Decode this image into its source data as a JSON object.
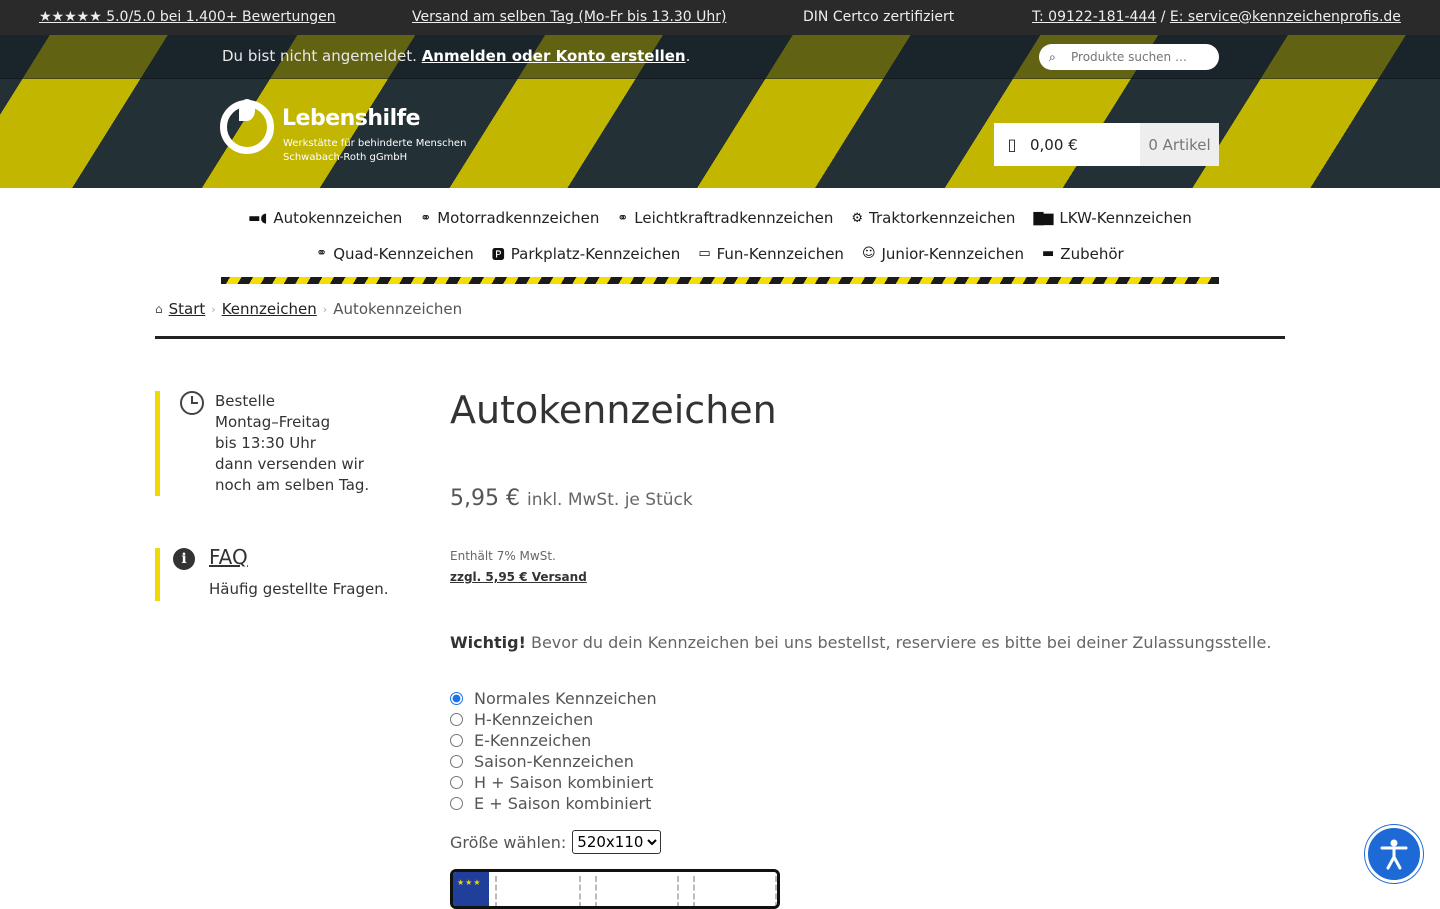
{
  "topbar": {
    "rating": "★★★★★ 5.0/5.0 bei 1.400+ Bewertungen",
    "shipping": "Versand am selben Tag (Mo-Fr bis 13.30 Uhr)",
    "certified": "DIN Certco zertifiziert",
    "phone": "T: 09122-181-444",
    "separator": "/",
    "email": "E: service@kennzeichenprofis.de"
  },
  "header": {
    "login_prefix": "Du bist nicht angemeldet.",
    "login_link": "Anmelden oder Konto erstellen",
    "login_suffix": ".",
    "search_placeholder": "Produkte suchen …",
    "logo_name": "Lebenshilfe",
    "logo_sub1": "Werkstätte für behinderte Menschen",
    "logo_sub2": "Schwabach-Roth gGmbH",
    "cart_amount": "0,00 €",
    "cart_count": "0 Artikel"
  },
  "nav": {
    "row1": [
      {
        "label": "Autokennzeichen",
        "icon": "car-icon"
      },
      {
        "label": "Motorradkennzeichen",
        "icon": "motorcycle-icon"
      },
      {
        "label": "Leichtkraftradkennzeichen",
        "icon": "scooter-icon"
      },
      {
        "label": "Traktorkennzeichen",
        "icon": "tractor-icon"
      },
      {
        "label": "LKW-Kennzeichen",
        "icon": "truck-icon"
      }
    ],
    "row2": [
      {
        "label": "Quad-Kennzeichen",
        "icon": "quad-icon"
      },
      {
        "label": "Parkplatz-Kennzeichen",
        "icon": "parking-icon"
      },
      {
        "label": "Fun-Kennzeichen",
        "icon": "plate-icon"
      },
      {
        "label": "Junior-Kennzeichen",
        "icon": "smiley-icon"
      },
      {
        "label": "Zubehör",
        "icon": "accessory-icon"
      }
    ]
  },
  "breadcrumb": {
    "home": "Start",
    "category": "Kennzeichen",
    "current": "Autokennzeichen"
  },
  "sidebar": {
    "order_lines": [
      "Bestelle",
      "Montag–Freitag",
      "bis 13:30 Uhr",
      "dann versenden wir",
      "noch am selben Tag."
    ],
    "faq_title": "FAQ",
    "faq_sub": "Häufig gestellte Fragen."
  },
  "product": {
    "title": "Autokennzeichen",
    "price": "5,95 €",
    "price_suffix": "inkl. MwSt. je Stück",
    "tax_note": "Enthält 7% MwSt.",
    "shipping_link": "zzgl. 5,95 € Versand",
    "important_label": "Wichtig!",
    "important_text": " Bevor du dein Kennzeichen bei uns bestellst, reserviere es bitte bei deiner Zulassungsstelle.",
    "options": [
      {
        "label": "Normales Kennzeichen",
        "checked": true
      },
      {
        "label": "H-Kennzeichen",
        "checked": false
      },
      {
        "label": "E-Kennzeichen",
        "checked": false
      },
      {
        "label": "Saison-Kennzeichen",
        "checked": false
      },
      {
        "label": "H + Saison kombiniert",
        "checked": false
      },
      {
        "label": "E + Saison kombiniert",
        "checked": false
      }
    ],
    "size_label": "Größe wählen:",
    "size_selected": "520x110"
  }
}
